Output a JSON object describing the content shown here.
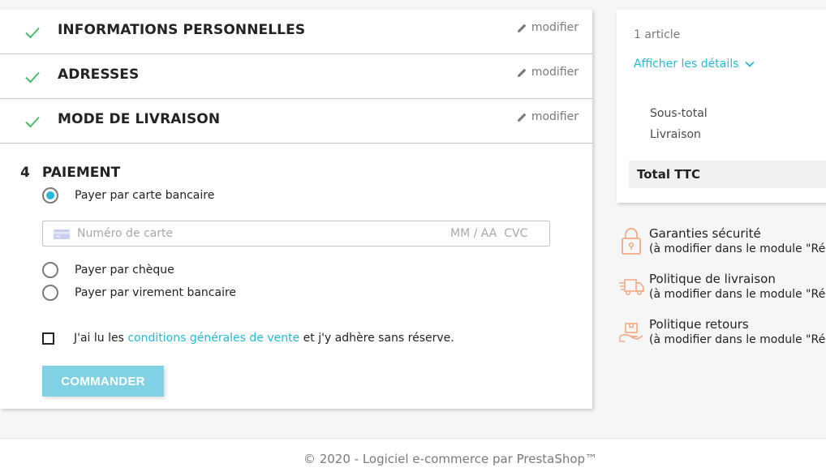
{
  "steps": [
    {
      "title": "INFORMATIONS PERSONNELLES",
      "edit_label": "modifier"
    },
    {
      "title": "ADRESSES",
      "edit_label": "modifier"
    },
    {
      "title": "MODE DE LIVRAISON",
      "edit_label": "modifier"
    }
  ],
  "payment": {
    "number": "4",
    "title": "PAIEMENT",
    "options": [
      {
        "label": "Payer par carte bancaire",
        "selected": true
      },
      {
        "label": "Payer par chèque",
        "selected": false
      },
      {
        "label": "Payer par virement bancaire",
        "selected": false
      }
    ],
    "card": {
      "placeholder": "Numéro de carte",
      "expiry_cvc": "MM / AA  CVC"
    },
    "tos": {
      "before": "J'ai lu les ",
      "link": "conditions générales de vente",
      "after": " et j'y adhère sans réserve.",
      "checked": false
    },
    "order_button": "COMMANDER"
  },
  "summary": {
    "count": "1 article",
    "details_link": "Afficher les détails",
    "subtotal_label": "Sous-total",
    "shipping_label": "Livraison",
    "total_label": "Total TTC"
  },
  "reassurance": [
    {
      "icon": "lock-icon",
      "title": "Garanties sécurité",
      "sub": "(à modifier dans le module \"Ré"
    },
    {
      "icon": "delivery-truck-icon",
      "title": "Politique de livraison",
      "sub": "(à modifier dans le module \"Ré"
    },
    {
      "icon": "return-package-icon",
      "title": "Politique retours",
      "sub": "(à modifier dans le module \"Ré"
    }
  ],
  "footer": "© 2020 - Logiciel e-commerce par PrestaShop™",
  "colors": {
    "accent": "#24b9d7",
    "check": "#4cbb6c",
    "button": "#7fd1e3",
    "reassurance_icon": "#f39d72"
  }
}
